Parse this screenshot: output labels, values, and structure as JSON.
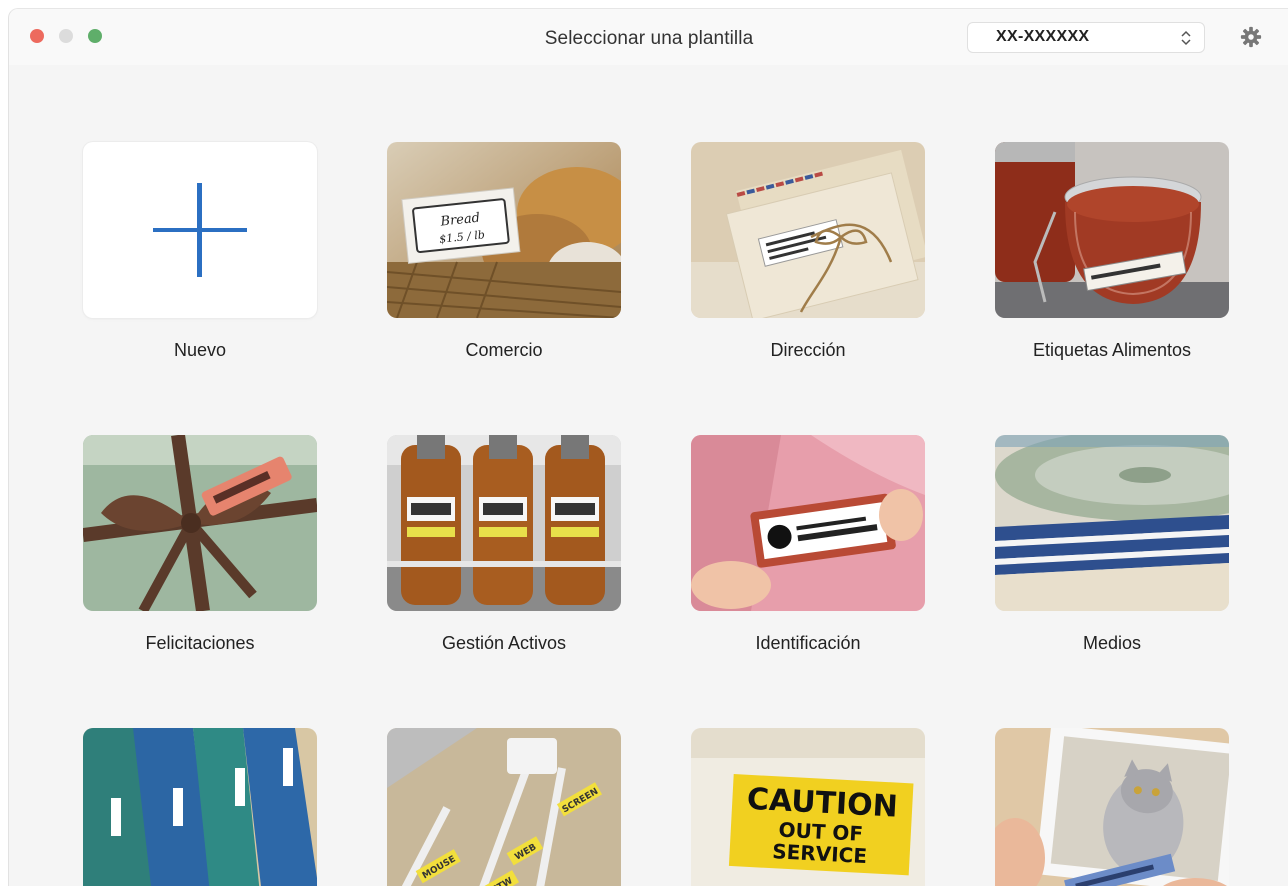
{
  "window": {
    "title": "Seleccionar una plantilla",
    "printer_select": {
      "value": "XX-XXXXXX"
    },
    "settings_icon": "gear-icon"
  },
  "templates": [
    {
      "label": "Nuevo"
    },
    {
      "label": "Comercio"
    },
    {
      "label": "Dirección"
    },
    {
      "label": "Etiquetas Alimentos"
    },
    {
      "label": "Felicitaciones"
    },
    {
      "label": "Gestión Activos"
    },
    {
      "label": "Identificación"
    },
    {
      "label": "Medios"
    },
    {
      "label": ""
    },
    {
      "label": ""
    },
    {
      "label": ""
    },
    {
      "label": ""
    }
  ],
  "images": {
    "comercio_tag": [
      "Bread",
      "$1.5 / lb"
    ],
    "caution_sign": [
      "CAUTION",
      "OUT OF",
      "SERVICE"
    ],
    "cable_tags": [
      "MOUSE",
      "WEB",
      "SCREEN",
      "NETW"
    ]
  },
  "colors": {
    "plus_accent": "#2b6fc2",
    "close": "#ed6a5e",
    "minimize": "#dcdcdc",
    "maximize": "#5fae6a"
  }
}
